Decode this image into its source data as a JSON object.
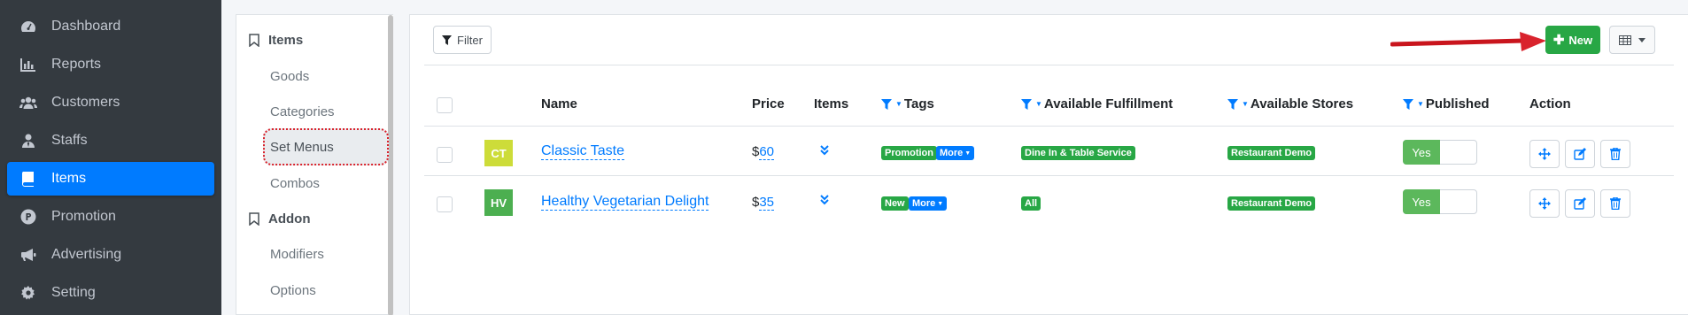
{
  "sidebar": {
    "items": [
      {
        "label": "Dashboard",
        "icon": "dashboard-icon"
      },
      {
        "label": "Reports",
        "icon": "bar-chart-icon"
      },
      {
        "label": "Customers",
        "icon": "users-icon"
      },
      {
        "label": "Staffs",
        "icon": "user-tie-icon"
      },
      {
        "label": "Items",
        "icon": "book-icon",
        "active": true
      },
      {
        "label": "Promotion",
        "icon": "product-hunt-icon"
      },
      {
        "label": "Advertising",
        "icon": "bullhorn-icon"
      },
      {
        "label": "Setting",
        "icon": "gear-icon"
      }
    ]
  },
  "submenu": {
    "items_heading": "Items",
    "items_links": [
      "Goods",
      "Categories",
      "Set Menus",
      "Combos"
    ],
    "addon_heading": "Addon",
    "addon_links": [
      "Modifiers",
      "Options"
    ]
  },
  "toolbar": {
    "filter_label": "Filter",
    "new_label": "New"
  },
  "table": {
    "columns": {
      "name": "Name",
      "price": "Price",
      "items": "Items",
      "tags": "Tags",
      "fulfillment": "Available Fulfillment",
      "stores": "Available Stores",
      "published": "Published",
      "action": "Action"
    },
    "rows": [
      {
        "initials": "CT",
        "avatar_color": "#cddc39",
        "name": "Classic Taste",
        "currency": "$",
        "price": "60",
        "tag": "Promotion",
        "more_label": "More",
        "fulfillment": "Dine In & Table Service",
        "store": "Restaurant Demo",
        "published": "Yes"
      },
      {
        "initials": "HV",
        "avatar_color": "#4caf50",
        "name": "Healthy Vegetarian Delight",
        "currency": "$",
        "price": "35",
        "tag": "New",
        "more_label": "More",
        "fulfillment": "All",
        "store": "Restaurant Demo",
        "published": "Yes"
      }
    ]
  },
  "colors": {
    "primary": "#007bff",
    "success": "#28a745",
    "sidebar_bg": "#343a40",
    "annotation_red": "#d9232d"
  }
}
